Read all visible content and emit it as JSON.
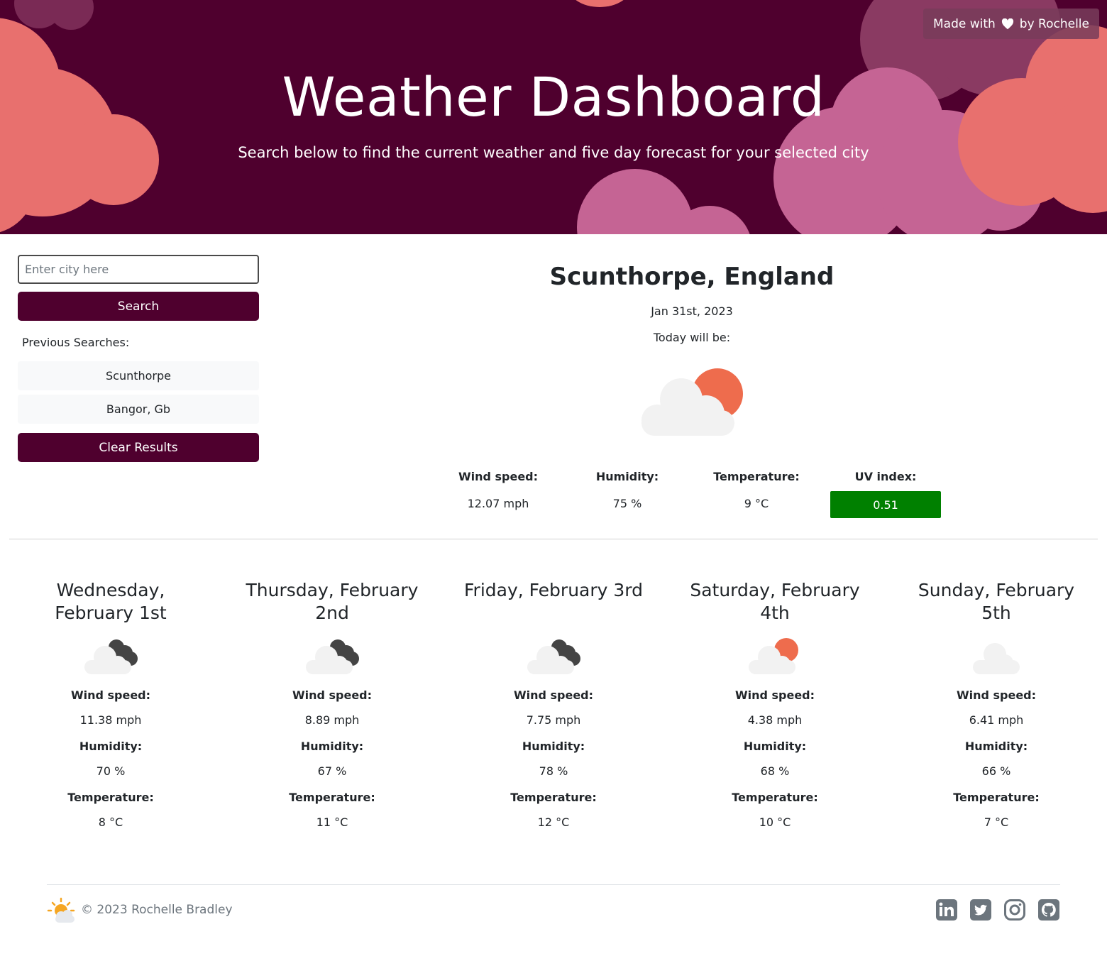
{
  "header": {
    "title": "Weather Dashboard",
    "subtitle": "Search below to find the current weather and five day forecast for your selected city",
    "made_with_prefix": "Made with",
    "made_with_suffix": "by Rochelle"
  },
  "search": {
    "placeholder": "Enter city here",
    "button_label": "Search",
    "previous_label": "Previous Searches:",
    "previous": [
      "Scunthorpe",
      "Bangor, Gb"
    ],
    "clear_label": "Clear Results"
  },
  "current": {
    "city": "Scunthorpe, England",
    "date": "Jan 31st, 2023",
    "today_label": "Today will be:",
    "icon": "partly-cloudy-sun-icon",
    "wind_label": "Wind speed:",
    "wind": "12.07 mph",
    "humidity_label": "Humidity:",
    "humidity": "75 %",
    "temp_label": "Temperature:",
    "temp": "9 °C",
    "uv_label": "UV index:",
    "uv": "0.51",
    "uv_color": "#008000"
  },
  "forecast": [
    {
      "day": "Wednesday, February 1st",
      "icon": "dark-clouds-icon",
      "wind_label": "Wind speed:",
      "wind": "11.38 mph",
      "humidity_label": "Humidity:",
      "humidity": "70 %",
      "temp_label": "Temperature:",
      "temp": "8 °C"
    },
    {
      "day": "Thursday, February 2nd",
      "icon": "dark-clouds-icon",
      "wind_label": "Wind speed:",
      "wind": "8.89 mph",
      "humidity_label": "Humidity:",
      "humidity": "67 %",
      "temp_label": "Temperature:",
      "temp": "11 °C"
    },
    {
      "day": "Friday, February 3rd",
      "icon": "dark-clouds-icon",
      "wind_label": "Wind speed:",
      "wind": "7.75 mph",
      "humidity_label": "Humidity:",
      "humidity": "78 %",
      "temp_label": "Temperature:",
      "temp": "12 °C"
    },
    {
      "day": "Saturday, February 4th",
      "icon": "partly-cloudy-sun-icon",
      "wind_label": "Wind speed:",
      "wind": "4.38 mph",
      "humidity_label": "Humidity:",
      "humidity": "68 %",
      "temp_label": "Temperature:",
      "temp": "10 °C"
    },
    {
      "day": "Sunday, February 5th",
      "icon": "cloud-icon",
      "wind_label": "Wind speed:",
      "wind": "6.41 mph",
      "humidity_label": "Humidity:",
      "humidity": "66 %",
      "temp_label": "Temperature:",
      "temp": "7 °C"
    }
  ],
  "footer": {
    "copyright": "© 2023 Rochelle Bradley",
    "social": [
      "linkedin-icon",
      "twitter-icon",
      "instagram-icon",
      "github-icon"
    ]
  },
  "colors": {
    "brand": "#4f002e",
    "cloud_coral": "#e8706e",
    "cloud_pink": "#c56494",
    "cloud_mauve": "#8a3a62",
    "sun": "#ee6c4d",
    "uv_low": "#008000"
  }
}
